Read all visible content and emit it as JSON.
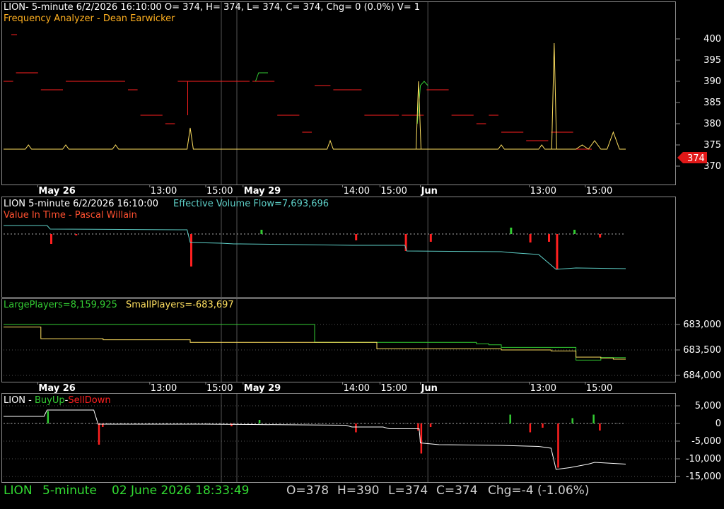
{
  "colors": {
    "red": "#ff2020",
    "yellow": "#ffe060",
    "green": "#33cc33",
    "cyan": "#5ed0c8",
    "white": "#ffffff",
    "grid": "#555555",
    "frame": "#8a8a8a"
  },
  "panel1": {
    "header": "LION- 5-minute 6/2/2026 16:10:00 O= 374, H= 374, L= 374, C= 374, Chg= 0 (0.0%) V= 1",
    "indicator": "Frequency Analyzer - Dean Earwicker",
    "last_price_tag": "374",
    "y_ticks": [
      "400",
      "395",
      "390",
      "385",
      "380",
      "375",
      "370"
    ]
  },
  "time_axis": [
    {
      "label": "May 26",
      "bold": true
    },
    {
      "label": "13:00",
      "bold": false
    },
    {
      "label": "15:00",
      "bold": false
    },
    {
      "label": "May 29",
      "bold": true
    },
    {
      "label": "14:00",
      "bold": false
    },
    {
      "label": "15:00",
      "bold": false
    },
    {
      "label": "Jun",
      "bold": true
    },
    {
      "label": "13:00",
      "bold": false
    },
    {
      "label": "15:00",
      "bold": false
    }
  ],
  "panel2": {
    "header": "LION 5-minute  6/2/2026 16:10:00",
    "evf": "Effective Volume Flow=7,693,696",
    "indicator": "Value In Time - Pascal Willain"
  },
  "panel3": {
    "large": "LargePlayers=8,159,925",
    "small": "SmallPlayers=-683,697",
    "y_ticks": [
      "683,000",
      "683,500",
      "684,000"
    ]
  },
  "panel4": {
    "prefix": "LION - ",
    "buy": "BuyUp",
    "dash": "-",
    "sell": "SellDown",
    "y_ticks": [
      "5,000",
      "0",
      "-5,000",
      "-10,000",
      "-15,000"
    ]
  },
  "status": {
    "symbol": "LION",
    "interval": "5-minute",
    "datetime": "02 June 2026 18:33:49",
    "open": "O=378",
    "high": "H=390",
    "low": "L=374",
    "close": "C=374",
    "change": "Chg=-4 (-1.06%)"
  },
  "chart_data": [
    {
      "type": "line",
      "title": "LION- 5-minute 6/2/2026 16:10:00 O= 374, H= 374, L= 374, C= 374, Chg= 0 (0.0%) V= 1",
      "ylim": [
        367,
        403
      ],
      "x": [
        0,
        2,
        3.5,
        4,
        4.5,
        6,
        8,
        9.5,
        10,
        10.5,
        12,
        14,
        16,
        17.5,
        18,
        18.5,
        20,
        22,
        24,
        26,
        28,
        29.5,
        30,
        30.5,
        32,
        35,
        38,
        40,
        42,
        44,
        46,
        48,
        50,
        52,
        52.5,
        53,
        54,
        56,
        58,
        60,
        61,
        62,
        64,
        66,
        68,
        70,
        70.5,
        71,
        72,
        74,
        76,
        78,
        79.5,
        80,
        80.5,
        82,
        84,
        86,
        86.5,
        87,
        88,
        90,
        92,
        93,
        94,
        95,
        96,
        96.5,
        97,
        98,
        99,
        100
      ],
      "series": [
        {
          "name": "Frequency Analyzer price",
          "values": [
            374,
            374,
            374,
            375,
            374,
            374,
            374,
            374,
            375,
            374,
            374,
            374,
            374,
            374,
            375,
            374,
            374,
            374,
            374,
            374,
            374,
            374,
            379,
            374,
            374,
            374,
            374,
            374,
            374,
            374,
            374,
            374,
            374,
            374,
            376,
            374,
            374,
            374,
            374,
            374,
            374,
            374,
            374,
            374,
            374,
            374,
            374,
            374,
            374,
            374,
            374,
            374,
            374,
            375,
            374,
            374,
            374,
            374,
            375,
            374,
            374,
            374,
            374,
            375,
            374,
            376,
            374,
            374,
            374,
            378,
            374,
            374
          ]
        }
      ],
      "red_levels": [
        [
          0,
          390
        ],
        [
          2,
          392
        ],
        [
          6,
          388
        ],
        [
          10,
          390
        ],
        [
          20,
          388
        ],
        [
          22,
          382
        ],
        [
          26,
          380
        ],
        [
          28,
          390
        ],
        [
          40,
          390
        ],
        [
          44,
          382
        ],
        [
          48,
          378
        ],
        [
          50,
          389
        ],
        [
          53,
          388
        ],
        [
          58,
          382
        ],
        [
          64,
          382
        ],
        [
          68,
          388
        ],
        [
          72,
          382
        ],
        [
          76,
          380
        ],
        [
          78,
          382
        ],
        [
          80,
          378
        ],
        [
          84,
          376
        ],
        [
          88,
          378
        ],
        [
          92,
          374
        ]
      ],
      "spike_high": 399
    },
    {
      "type": "bar",
      "title": "Value In Time - Pascal Willain",
      "series": [
        {
          "name": "Effective Volume Flow",
          "values": [
            7.8,
            7.78,
            7.75,
            7.72,
            7.7,
            7.69
          ]
        }
      ]
    },
    {
      "type": "line",
      "title": "LargePlayers / SmallPlayers",
      "ylim": [
        684100,
        682900
      ],
      "x": [
        0,
        2,
        4,
        6,
        8,
        10,
        12,
        14,
        16,
        18,
        20,
        22,
        24,
        26,
        28,
        30,
        32,
        34,
        36,
        38,
        40,
        42,
        44,
        46,
        48,
        50,
        52,
        54,
        56,
        58,
        60,
        62,
        64,
        66,
        68,
        70,
        72,
        74,
        76,
        78,
        80,
        82,
        84,
        86,
        88,
        90,
        92,
        94,
        96,
        98,
        100
      ],
      "series": [
        {
          "name": "LargePlayers",
          "values": [
            683000,
            683000,
            683000,
            683000,
            683000,
            683000,
            683000,
            683000,
            683000,
            683000,
            683000,
            683000,
            683000,
            683000,
            683000,
            683000,
            683000,
            683000,
            683000,
            683000,
            683000,
            683000,
            683000,
            683000,
            683000,
            683350,
            683350,
            683350,
            683350,
            683350,
            683350,
            683350,
            683350,
            683350,
            683350,
            683350,
            683350,
            683350,
            683380,
            683400,
            683450,
            683450,
            683450,
            683450,
            683450,
            683450,
            683700,
            683700,
            683650,
            683650,
            683650
          ]
        },
        {
          "name": "SmallPlayers",
          "values": [
            683050,
            683050,
            683050,
            683280,
            683280,
            683280,
            683280,
            683280,
            683300,
            683300,
            683300,
            683300,
            683300,
            683300,
            683300,
            683350,
            683350,
            683350,
            683350,
            683350,
            683350,
            683350,
            683350,
            683350,
            683350,
            683350,
            683350,
            683350,
            683350,
            683350,
            683480,
            683480,
            683480,
            683480,
            683480,
            683480,
            683480,
            683480,
            683480,
            683480,
            683500,
            683500,
            683500,
            683500,
            683520,
            683520,
            683640,
            683640,
            683660,
            683680,
            683680
          ]
        }
      ]
    },
    {
      "type": "bar",
      "title": "LION - BuyUp-SellDown",
      "ylim": [
        -15000,
        5000
      ],
      "series": [
        {
          "name": "BuyUp-SellDown line",
          "values": [
            2000,
            1900,
            2000,
            3800,
            3800,
            -200,
            -200,
            -200,
            -200,
            -500,
            -500,
            -500,
            -1000,
            -1000,
            -1500,
            -5500,
            -6000,
            -6200,
            -6500,
            -6800,
            -13000,
            -12000,
            -11500,
            -11500
          ]
        }
      ]
    }
  ]
}
